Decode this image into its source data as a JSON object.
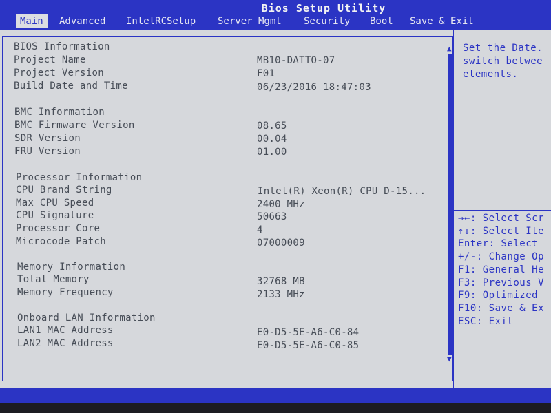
{
  "title": "Bios Setup Utility",
  "tabs": [
    {
      "label": "Main",
      "active": true
    },
    {
      "label": "Advanced"
    },
    {
      "label": "IntelRCSetup"
    },
    {
      "label": "Server Mgmt"
    },
    {
      "label": "Security"
    },
    {
      "label": "Boot"
    },
    {
      "label": "Save & Exit"
    }
  ],
  "sections": [
    {
      "heading": "BIOS Information",
      "rows": [
        {
          "label": "Project Name",
          "value": "MB10-DATTO-07"
        },
        {
          "label": "Project Version",
          "value": "F01"
        },
        {
          "label": "Build Date and Time",
          "value": "06/23/2016 18:47:03"
        }
      ]
    },
    {
      "heading": "BMC Information",
      "rows": [
        {
          "label": "BMC Firmware Version",
          "value": "08.65"
        },
        {
          "label": "SDR Version",
          "value": "00.04"
        },
        {
          "label": "FRU Version",
          "value": "01.00"
        }
      ]
    },
    {
      "heading": "Processor Information",
      "rows": [
        {
          "label": "CPU Brand String",
          "value": "Intel(R) Xeon(R) CPU D-15..."
        },
        {
          "label": "Max CPU Speed",
          "value": "2400 MHz"
        },
        {
          "label": "CPU Signature",
          "value": "50663"
        },
        {
          "label": "Processor Core",
          "value": "4"
        },
        {
          "label": "Microcode Patch",
          "value": "07000009"
        }
      ]
    },
    {
      "heading": "Memory Information",
      "rows": [
        {
          "label": "Total Memory",
          "value": "32768 MB"
        },
        {
          "label": "Memory Frequency",
          "value": "2133 MHz"
        }
      ]
    },
    {
      "heading": "Onboard LAN Information",
      "rows": [
        {
          "label": "LAN1 MAC Address",
          "value": "E0-D5-5E-A6-C0-84"
        },
        {
          "label": "LAN2 MAC Address",
          "value": "E0-D5-5E-A6-C0-85"
        }
      ]
    }
  ],
  "help_text": [
    "Set the Date.",
    "switch betwee",
    "elements."
  ],
  "key_help": [
    "→←: Select Scr",
    "↑↓: Select Ite",
    "Enter: Select",
    "+/-: Change Op",
    "F1: General He",
    "F3: Previous V",
    "F9: Optimized",
    "F10: Save & Ex",
    "ESC: Exit"
  ],
  "scroll_up_icon": "arrow-up-icon",
  "scroll_down_icon": "arrow-down-icon",
  "colors": {
    "accent": "#2b34c4",
    "background": "#d6d8dc",
    "text": "#474d57"
  }
}
